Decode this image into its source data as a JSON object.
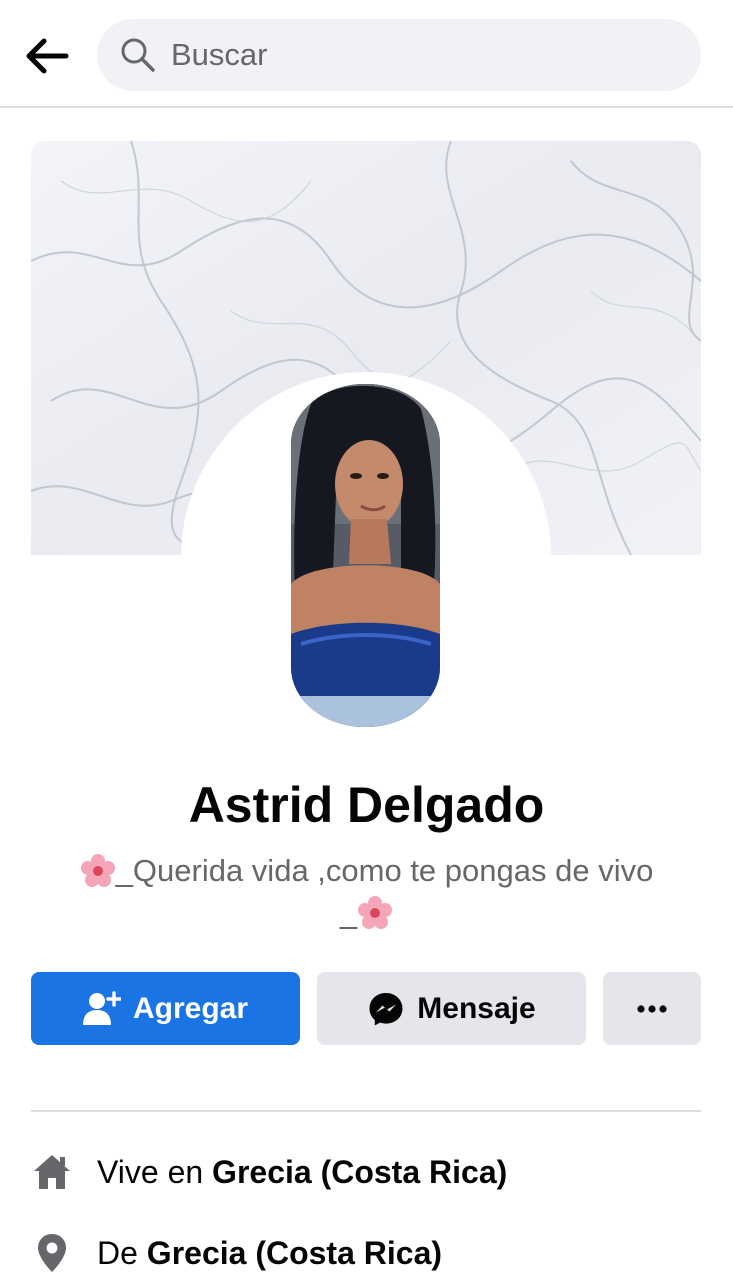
{
  "header": {
    "back_icon": "arrow-left-icon",
    "search_placeholder": "Buscar",
    "search_icon": "search-icon"
  },
  "profile": {
    "name": "Astrid Delgado",
    "bio_line1": "_Querida vida ,como te pongas de vivo",
    "bio_line2": "_",
    "bio_emoji": "cherry-blossom-icon",
    "cover": "marble-cover-image",
    "avatar": "profile-photo"
  },
  "actions": {
    "add_label": "Agregar",
    "add_icon": "add-friend-icon",
    "message_label": "Mensaje",
    "message_icon": "messenger-icon",
    "more_label": "•••",
    "more_icon": "more-options-icon"
  },
  "info": [
    {
      "icon": "home-icon",
      "prefix": "Vive en ",
      "value": "Grecia (Costa Rica)"
    },
    {
      "icon": "location-pin-icon",
      "prefix": "De ",
      "value": "Grecia (Costa Rica)"
    }
  ],
  "colors": {
    "primary": "#1b74e4",
    "secondary_button": "#e4e6eb",
    "text_primary": "#050505",
    "text_secondary": "#65676b",
    "divider": "#dadde1"
  }
}
